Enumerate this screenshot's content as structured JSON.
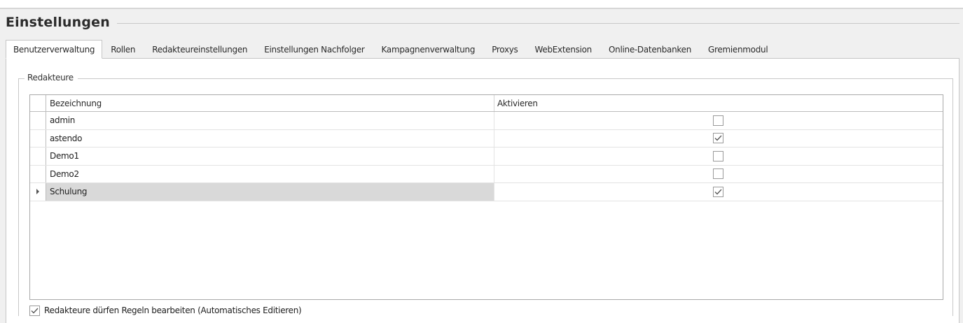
{
  "window": {
    "title": "Einstellungen"
  },
  "tabs": [
    {
      "label": "Benutzerverwaltung",
      "active": true
    },
    {
      "label": "Rollen",
      "active": false
    },
    {
      "label": "Redakteureinstellungen",
      "active": false
    },
    {
      "label": "Einstellungen Nachfolger",
      "active": false
    },
    {
      "label": "Kampagnenverwaltung",
      "active": false
    },
    {
      "label": "Proxys",
      "active": false
    },
    {
      "label": "WebExtension",
      "active": false
    },
    {
      "label": "Online-Datenbanken",
      "active": false
    },
    {
      "label": "Gremienmodul",
      "active": false
    }
  ],
  "group": {
    "title": "Redakteure",
    "grid": {
      "columns": {
        "name": "Bezeichnung",
        "active": "Aktivieren"
      },
      "rows": [
        {
          "name": "admin",
          "active": false,
          "selected": false
        },
        {
          "name": "astendo",
          "active": true,
          "selected": false
        },
        {
          "name": "Demo1",
          "active": false,
          "selected": false
        },
        {
          "name": "Demo2",
          "active": false,
          "selected": false
        },
        {
          "name": "Schulung",
          "active": true,
          "selected": true
        }
      ]
    },
    "option": {
      "label": "Redakteure dürfen Regeln bearbeiten (Automatisches Editieren)",
      "checked": true
    }
  },
  "icons": {
    "check": "checkmark-icon",
    "row_indicator": "row-indicator-arrow-icon"
  },
  "colors": {
    "background": "#f0f0f0",
    "panel": "#ffffff",
    "selected_row": "#d9d9d9",
    "border": "#c6c6c6"
  }
}
